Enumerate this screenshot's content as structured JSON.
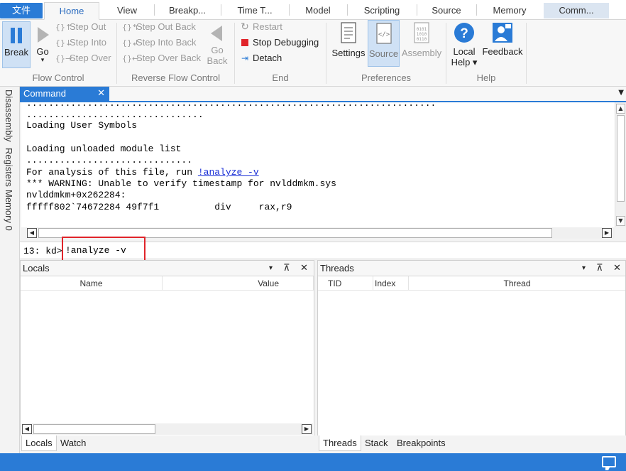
{
  "tabs": {
    "file": "文件",
    "home": "Home",
    "view": "View",
    "breakpoints": "Breakp...",
    "time_travel": "Time T...",
    "model": "Model",
    "scripting": "Scripting",
    "source": "Source",
    "memory": "Memory",
    "command": "Comm..."
  },
  "ribbon": {
    "flow_control": {
      "label": "Flow Control",
      "break": "Break",
      "go": "Go",
      "go_arrow": "▾",
      "step_out": "Step Out",
      "step_into": "Step Into",
      "step_over": "Step Over"
    },
    "reverse_flow_control": {
      "label": "Reverse Flow Control",
      "step_out_back": "Step Out Back",
      "step_into_back": "Step Into Back",
      "step_over_back": "Step Over Back",
      "go_back_line1": "Go",
      "go_back_line2": "Back"
    },
    "end": {
      "label": "End",
      "restart": "Restart",
      "stop_debugging": "Stop Debugging",
      "detach": "Detach"
    },
    "preferences": {
      "label": "Preferences",
      "settings": "Settings",
      "source": "Source",
      "assembly": "Assembly"
    },
    "help": {
      "label": "Help",
      "local_help_line1": "Local",
      "local_help_line2": "Help ▾",
      "feedback": "Feedback"
    }
  },
  "side_tabs": {
    "disassembly": "Disassembly",
    "registers": "Registers",
    "memory0": "Memory 0"
  },
  "command_window": {
    "title": "Command",
    "close_glyph": "✕",
    "output": {
      "line0": "..........................................................................",
      "line1": "................................",
      "line2": "Loading User Symbols",
      "line3": "",
      "line4": "Loading unloaded module list",
      "line5": "..............................",
      "line6_prefix": "For analysis of this file, run ",
      "line6_link": "!analyze -v",
      "line7": "*** WARNING: Unable to verify timestamp for nvlddmkm.sys",
      "line8": "nvlddmkm+0x262284:",
      "line9": "fffff802`74672284 49f7f1          div     rax,r9"
    },
    "prompt": "13: kd>",
    "input_value": "!analyze -v"
  },
  "locals_pane": {
    "title": "Locals",
    "columns": [
      "Name",
      "Value"
    ],
    "tabs": [
      "Locals",
      "Watch"
    ]
  },
  "threads_pane": {
    "title": "Threads",
    "columns": [
      "TID",
      "Index",
      "Thread"
    ],
    "tabs": [
      "Threads",
      "Stack",
      "Breakpoints"
    ]
  },
  "pane_controls": {
    "dropdown": "▾",
    "pin": "⊼",
    "close": "✕"
  },
  "colors": {
    "accent": "#2a7bd6",
    "highlight": "#e0242a",
    "link": "#1a2fd6"
  }
}
